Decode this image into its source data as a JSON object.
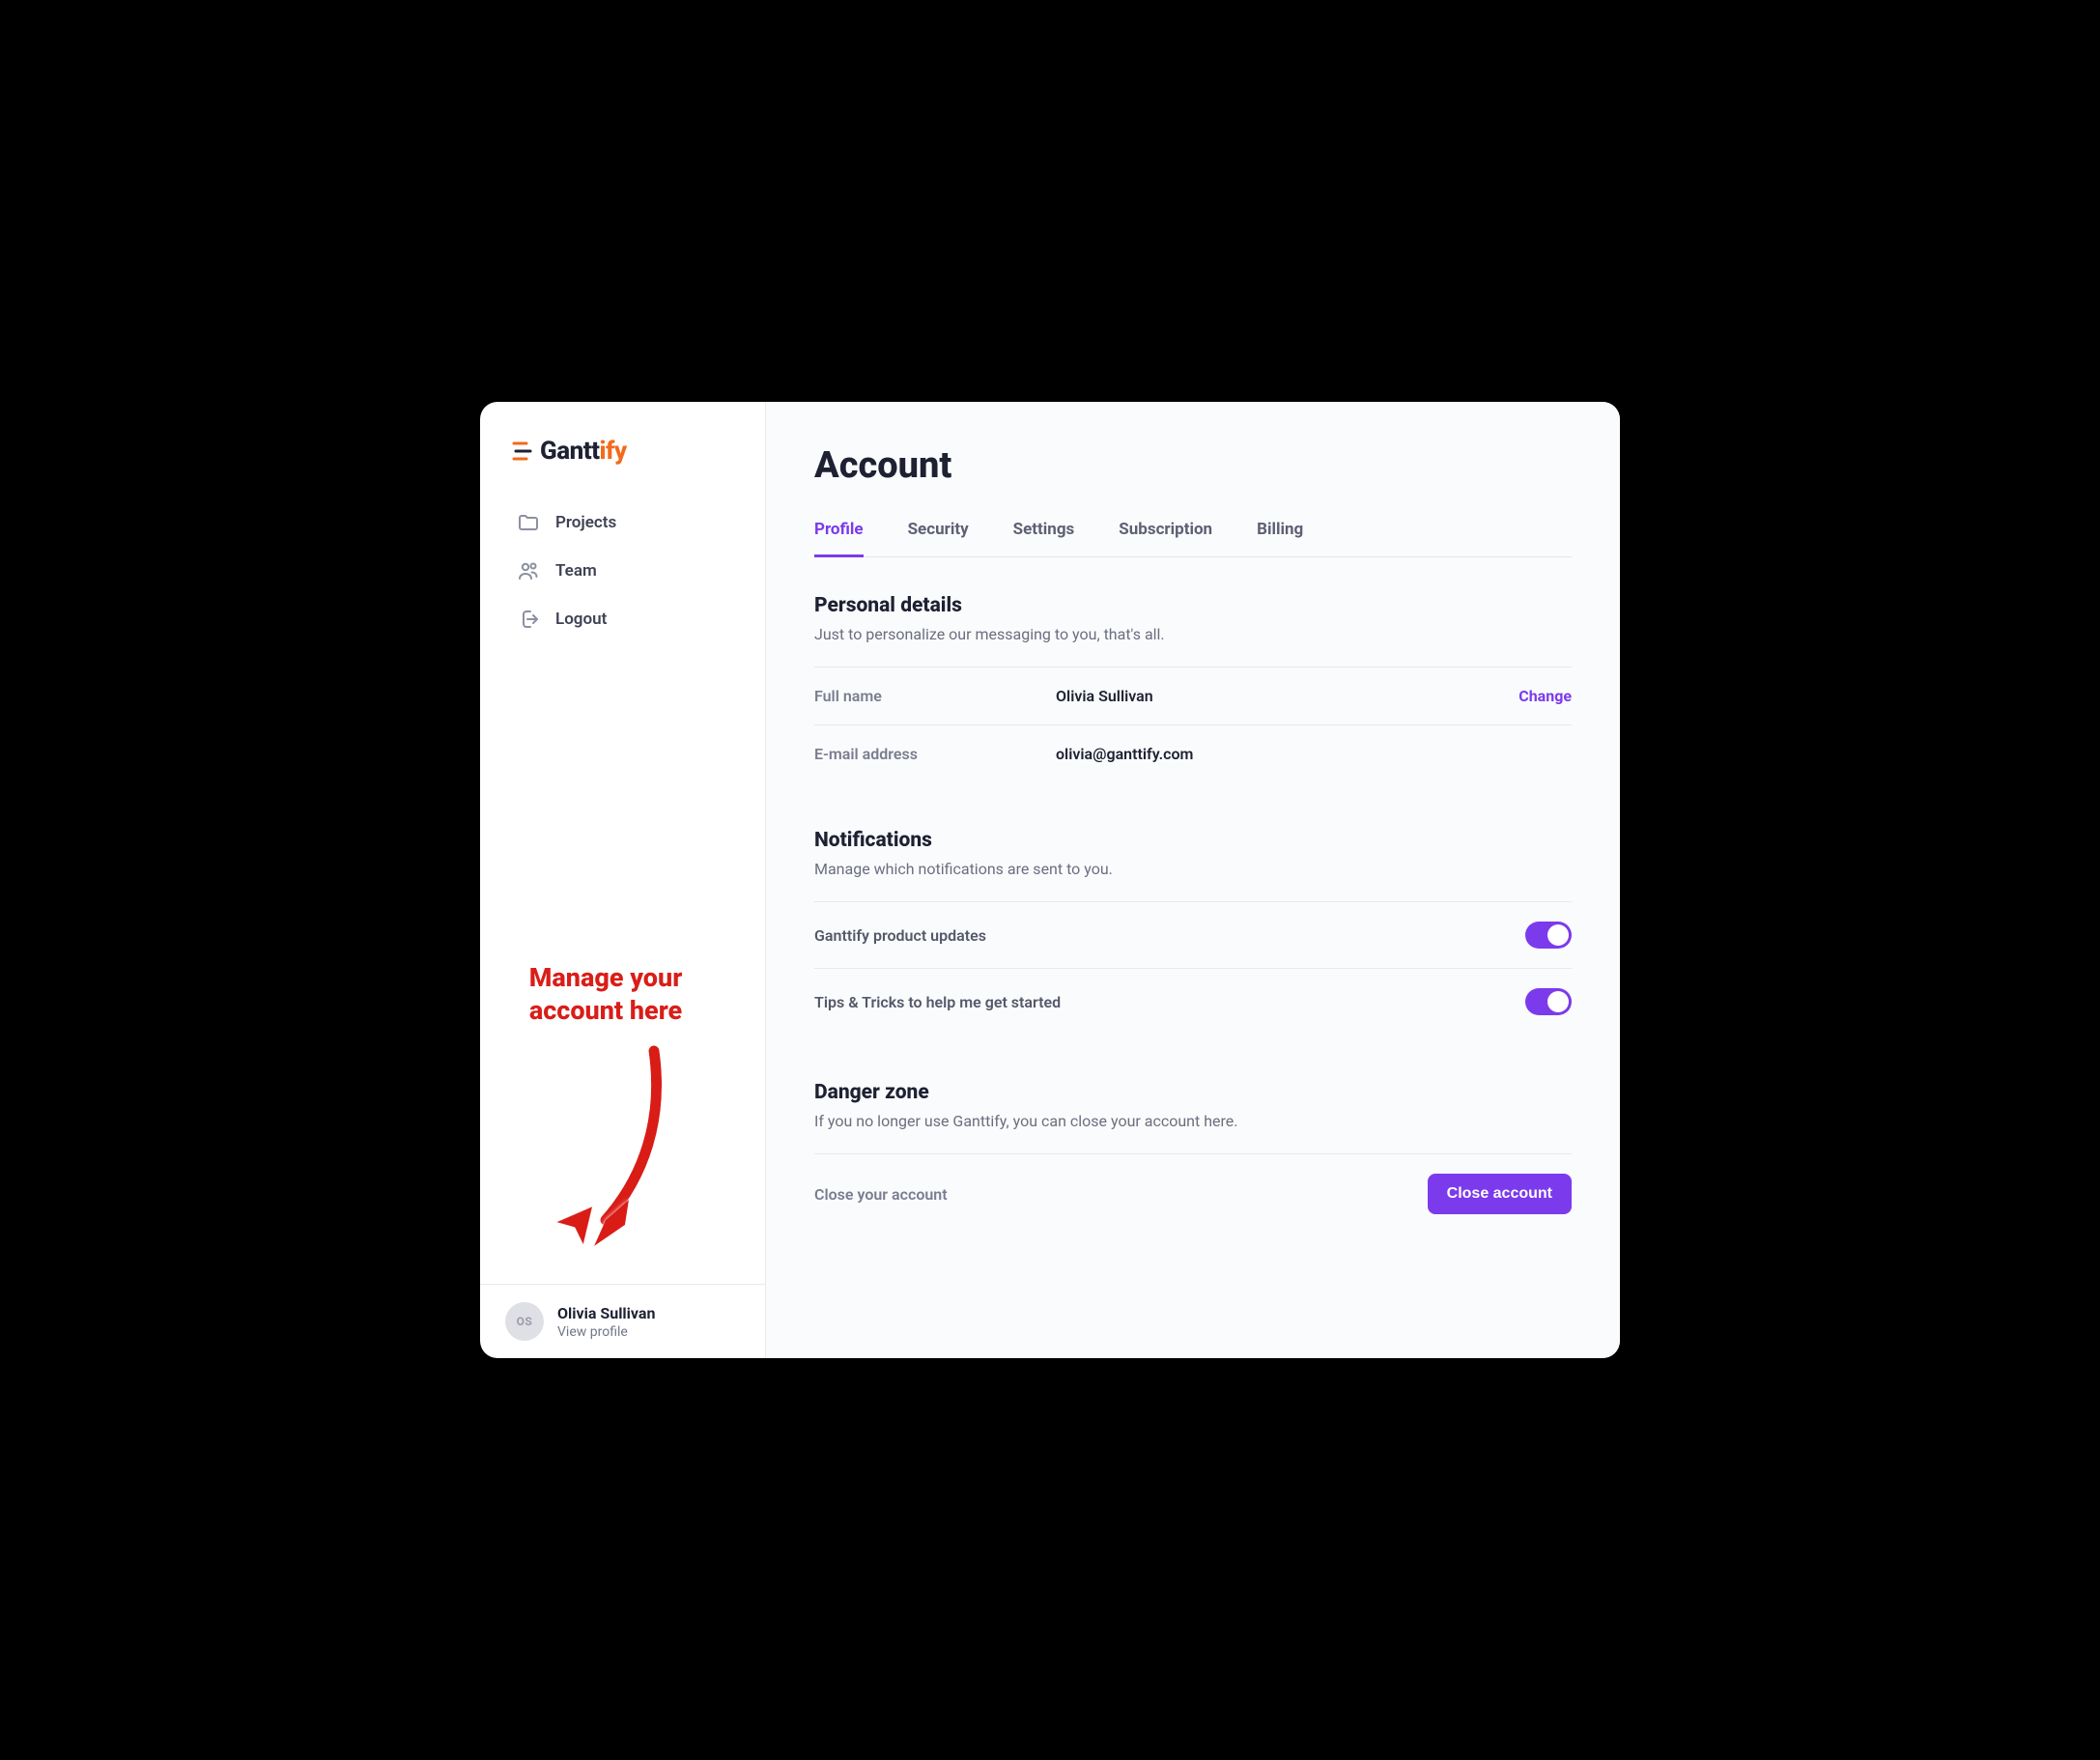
{
  "logo": {
    "part1": "Gantt",
    "part2": "ify"
  },
  "sidebar": {
    "items": [
      {
        "label": "Projects"
      },
      {
        "label": "Team"
      },
      {
        "label": "Logout"
      }
    ]
  },
  "user": {
    "initials": "OS",
    "name": "Olivia Sullivan",
    "view_profile": "View profile"
  },
  "page": {
    "title": "Account"
  },
  "tabs": [
    {
      "label": "Profile",
      "active": true
    },
    {
      "label": "Security"
    },
    {
      "label": "Settings"
    },
    {
      "label": "Subscription"
    },
    {
      "label": "Billing"
    }
  ],
  "personal": {
    "title": "Personal details",
    "sub": "Just to personalize our messaging to you, that's all.",
    "full_name_label": "Full name",
    "full_name_value": "Olivia Sullivan",
    "change_action": "Change",
    "email_label": "E-mail address",
    "email_value": "olivia@ganttify.com"
  },
  "notifications": {
    "title": "Notifications",
    "sub": "Manage which notifications are sent to you.",
    "item1_label": "Ganttify product updates",
    "item1_on": true,
    "item2_label": "Tips & Tricks to help me get started",
    "item2_on": true
  },
  "danger": {
    "title": "Danger zone",
    "sub": "If you no longer use Ganttify, you can close your account here.",
    "row_label": "Close your account",
    "button": "Close account"
  },
  "annotation": {
    "line1": "Manage your",
    "line2": "account here"
  },
  "colors": {
    "accent": "#7c3aed",
    "annotation": "#d91e18",
    "logo_orange": "#f26a1b"
  }
}
